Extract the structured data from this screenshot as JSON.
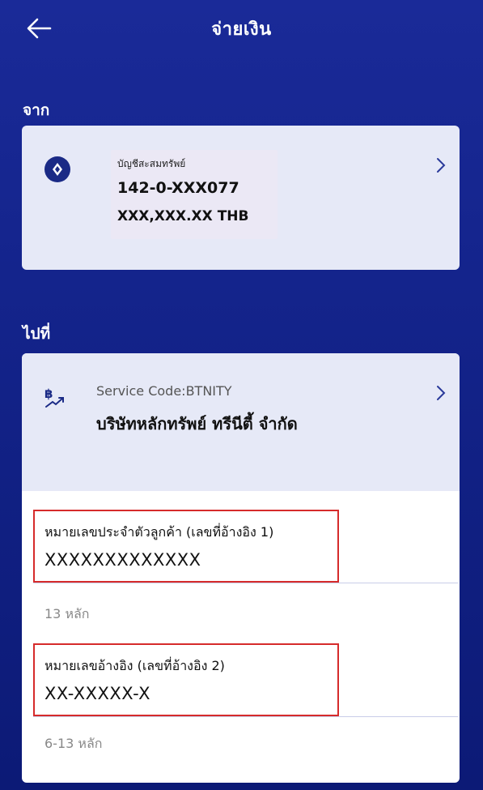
{
  "header": {
    "title": "จ่ายเงิน",
    "back_icon": "arrow-left-icon"
  },
  "from": {
    "label": "จาก",
    "account_type": "บัญชีสะสมทรัพย์",
    "account_number": "142-0-XXX077",
    "balance": "XXX,XXX.XX THB",
    "icon": "bank-logo-icon"
  },
  "to": {
    "label": "ไปที่",
    "service_code": "Service Code:BTNITY",
    "biller_name": "บริษัทหลักทรัพย์ ทรีนีตี้ จำกัด",
    "icon": "baht-transfer-icon"
  },
  "fields": [
    {
      "label": "หมายเลขประจำตัวลูกค้า (เลขที่อ้างอิง 1)",
      "value": "XXXXXXXXXXXXX",
      "helper": "13 หลัก"
    },
    {
      "label": "หมายเลขอ้างอิง (เลขที่อ้างอิง 2)",
      "value": "XX-XXXXX-X",
      "helper": "6-13 หลัก"
    }
  ],
  "colors": {
    "background_top": "#1a2a98",
    "background_bottom": "#0c1a76",
    "card": "#e6e9f7",
    "highlight_border": "#d62b2b"
  }
}
